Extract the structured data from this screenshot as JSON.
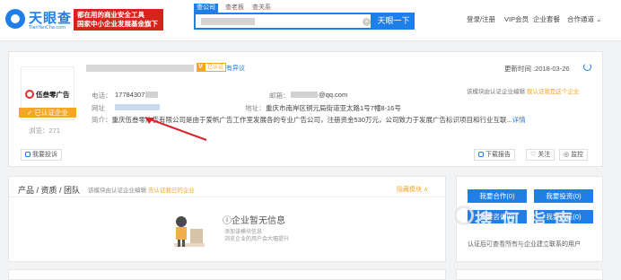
{
  "brand": {
    "name": "天眼查",
    "domain": "TianYanCha.com",
    "slogan_line1": "都在用的商业安全工具",
    "slogan_line2": "国家中小企业发展基金旗下"
  },
  "search": {
    "tabs": [
      {
        "label": "查公司"
      },
      {
        "label": "查老板"
      },
      {
        "label": "查关系"
      }
    ],
    "button": "天眼一下",
    "clear_icon": "×"
  },
  "nav": {
    "login": "登录/注册",
    "vip": "VIP会员",
    "package": "企业套餐",
    "channel": "合作通道"
  },
  "company": {
    "logo_text": "伍叁零广告",
    "verified_tag": "已认证企业",
    "views": "浏览：271",
    "v_badge": "V",
    "v_text": "已认证",
    "abnormal": "有异议",
    "update_time": "更新时间 :2018-03-26",
    "phone_label": "电话：",
    "phone_value": "17784307",
    "website_label": "网址",
    "email_label": "邮箱：",
    "email_suffix": "@qq.com",
    "address_label": "地址：",
    "address_value": "重庆市南岸区铜元局街道亚太路1号7幢8-16号",
    "notice_text": "该模块由认证企业编辑",
    "notice_link": "我认证我是这个企业",
    "intro_label": "简介：",
    "intro_text": "重庆伍叁零广告有限公司是由于爱帆广告工作室发展各的专业广告公司，注册资金530万元，公司致力于发展广告标识项目和行业互联...",
    "intro_more": "详情",
    "report_btn": "我要投诉",
    "download_btn": "下载报告",
    "follow_btn": "关注",
    "monitor_btn": "监控"
  },
  "products": {
    "title": "产品 / 资质 / 团队",
    "note": "该模块由认证企业编辑",
    "note_link": "去认证我已的企业",
    "hide": "隐藏模块 ∧",
    "empty_title": "企业暂无信息",
    "empty_sub1": "添加该模块信息",
    "empty_sub2": "浏览企业的用户会大幅提升"
  },
  "side": {
    "cooperate_btn": "我要合作(0)",
    "invest_btn": "我要投资(0)",
    "consult_btn": "我要咨询(0)",
    "claim_btn": "我要认证(0)",
    "note": "认证后可查看所有与企业建立联系的用户"
  },
  "watermark": {
    "text": "搜 何 指 南",
    "sub": "chinamaojie.com"
  },
  "colors": {
    "accent": "#1f7ee8",
    "brand_red": "#d6231b",
    "verified_orange": "#f5a623"
  },
  "icons": {
    "refresh": "refresh-icon",
    "report": "warning-icon",
    "download": "download-icon",
    "heart": "heart-icon",
    "monitor": "eye-icon"
  }
}
